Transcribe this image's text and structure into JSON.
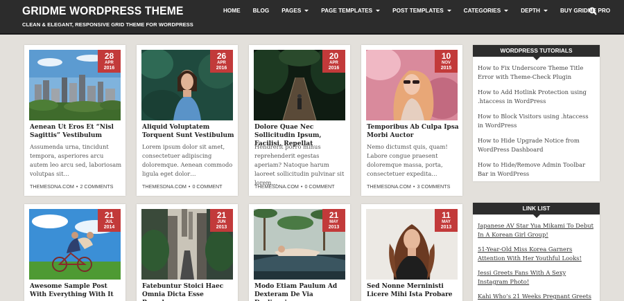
{
  "header": {
    "site_title": "GRIDME WORDPRESS THEME",
    "tagline": "CLEAN & ELEGANT, RESPONSIVE GRID THEME FOR WORDPRESS",
    "nav": [
      {
        "label": "HOME",
        "dropdown": false
      },
      {
        "label": "BLOG",
        "dropdown": false
      },
      {
        "label": "PAGES",
        "dropdown": true
      },
      {
        "label": "PAGE TEMPLATES",
        "dropdown": true
      },
      {
        "label": "POST TEMPLATES",
        "dropdown": true
      },
      {
        "label": "CATEGORIES",
        "dropdown": true
      },
      {
        "label": "DEPTH",
        "dropdown": true
      },
      {
        "label": "BUY GRIDME PRO",
        "dropdown": false
      }
    ]
  },
  "posts": [
    {
      "day": "28",
      "month": "APR",
      "year": "2016",
      "title": "Aenean Ut Eros Et “Nisl Sagittis” Vestibulum",
      "excerpt": "Assumenda urna, tincidunt tempora, asperiores arcu autem leo arcu sed, laboriosam volutpas sit…",
      "author": "THEMESDNA.COM",
      "comments": "2 COMMENTS",
      "image": "city-skyline"
    },
    {
      "day": "26",
      "month": "APR",
      "year": "2016",
      "title": "Aliquid Voluptatem Torquent Sunt Vestibulum",
      "excerpt": "Lorem ipsum dolor sit amet, consectetuer adipiscing doloremque. Aenean commodo ligula eget dolor…",
      "author": "THEMESDNA.COM",
      "comments": "0 COMMENT",
      "image": "woman-portrait"
    },
    {
      "day": "20",
      "month": "APR",
      "year": "2016",
      "title": "Dolore Quae Nec Sollicitudin Ipsum, Facilisi, Repellat",
      "excerpt": "Hendrerit porro minus reprehenderit egestas aperiam? Natoque harum laoreet sollicitudin pulvinar sit lorem…",
      "author": "THEMESDNA.COM",
      "comments": "0 COMMENT",
      "image": "forest-bridge"
    },
    {
      "day": "10",
      "month": "NOV",
      "year": "2015",
      "title": "Temporibus Ab Culpa Ipsa Morbi Auctor",
      "excerpt": "Nemo dictumst quis, quam! Labore congue praesent doloremque massa, porta, consectetuer expedita…",
      "author": "THEMESDNA.COM",
      "comments": "3 COMMENTS",
      "image": "woman-sunglasses"
    },
    {
      "day": "21",
      "month": "JUL",
      "year": "2014",
      "title": "Awesome Sample Post With Everything With It",
      "image": "bicycle-couple"
    },
    {
      "day": "21",
      "month": "JUN",
      "year": "2013",
      "title": "Fatebuntur Stoici Haec Omnia Dicta Esse Praeclare",
      "image": "city-street"
    },
    {
      "day": "21",
      "month": "MAY",
      "year": "2013",
      "title": "Modo Etiam Paulum Ad Dexteram De Via Declinavi",
      "image": "woman-car-palms"
    },
    {
      "day": "11",
      "month": "MAY",
      "year": "2013",
      "title": "Sed Nonne Merninisti Licere Mihi Ista Probare",
      "image": "woman-leather-jacket"
    }
  ],
  "sidebar": {
    "tutorials": {
      "title": "WORDPRESS TUTORIALS",
      "items": [
        "How to Fix Underscore Theme Title Error with Theme-Check Plugin",
        "How to Add Hotlink Protection using .htaccess in WordPress",
        "How to Block Visitors using .htaccess in WordPress",
        "How to Hide Upgrade Notice from WordPress Dashboard",
        "How to Hide/Remove Admin Toolbar Bar in WordPress"
      ]
    },
    "links": {
      "title": "LINK LIST",
      "items": [
        "Japanese AV Star Yua Mikami To Debut In A Korean Girl Group!",
        "51-Year-Old Miss Korea Garners Attention With Her Youthful Looks!",
        "Jessi Greets Fans With A Sexy Instagram Photo!",
        "Kahi Who’s 21 Weeks Pregnant Greets"
      ]
    }
  },
  "colors": {
    "header_bg": "#2c2c2c",
    "badge": "#c23a3a",
    "page_bg": "#e3e0db"
  }
}
